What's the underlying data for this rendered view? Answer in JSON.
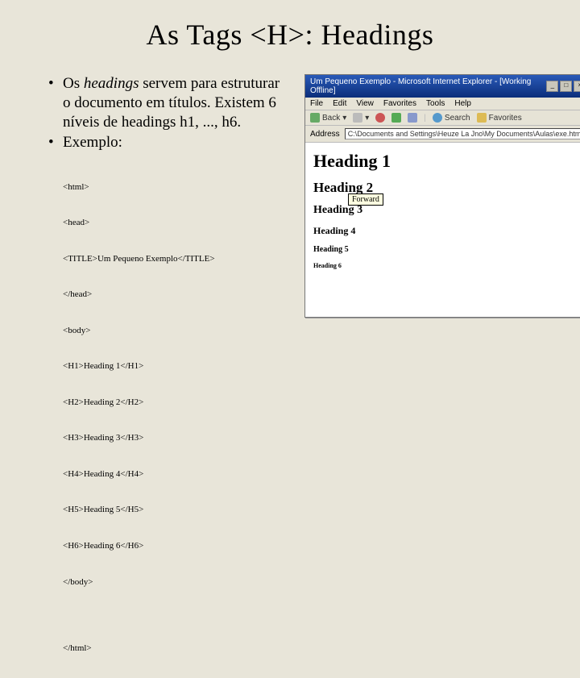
{
  "title": "As Tags <H>: Headings",
  "bullet1_pre": "Os ",
  "bullet1_em": "headings",
  "bullet1_post": " servem para estruturar o documento em títulos. Existem 6 níveis de headings h1, ..., h6.",
  "bullet2": "Exemplo:",
  "code_lines": [
    "<html>",
    "<head>",
    "<TITLE>Um Pequeno Exemplo</TITLE>",
    "</head>",
    "<body>",
    "<H1>Heading 1</H1>",
    "<H2>Heading 2</H2>",
    "<H3>Heading 3</H3>",
    "<H4>Heading 4</H4>",
    "<H5>Heading 5</H5>",
    "<H6>Heading 6</H6>",
    "</body>",
    "",
    "</html>"
  ],
  "ie": {
    "title": "Um Pequeno Exemplo - Microsoft Internet Explorer - [Working Offline]",
    "menu": [
      "File",
      "Edit",
      "View",
      "Favorites",
      "Tools",
      "Help"
    ],
    "tool_back": "Back",
    "tool_search": "Search",
    "tool_fav": "Favorites",
    "addr_label": "Address",
    "addr_value": "C:\\Documents and Settings\\Heuze La Jno\\My Documents\\Aulas\\exe.html",
    "tooltip": "Forward",
    "h1": "Heading 1",
    "h2": "Heading 2",
    "h3": "Heading 3",
    "h4": "Heading 4",
    "h5": "Heading 5",
    "h6": "Heading 6"
  }
}
